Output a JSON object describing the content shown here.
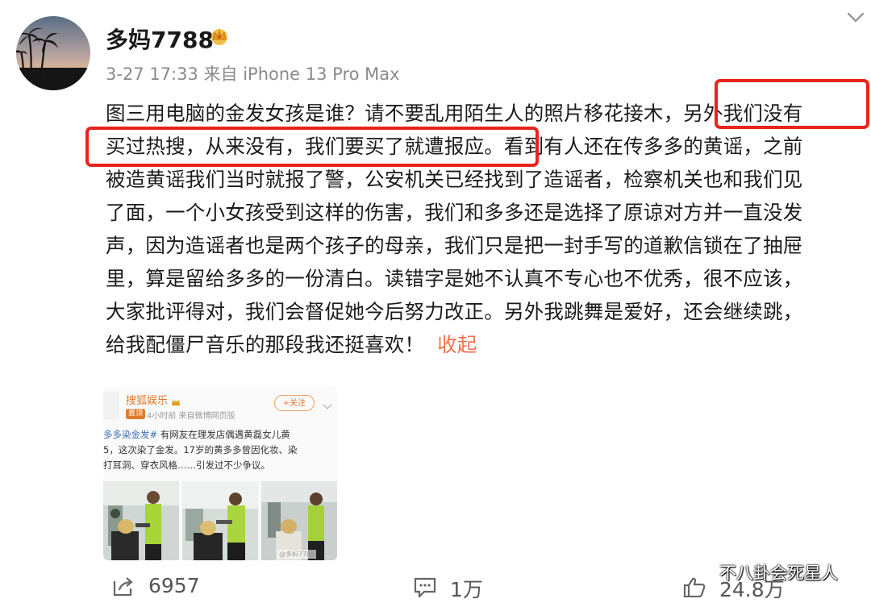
{
  "post": {
    "author": "多妈7788",
    "meta": "3-27 17:33  来自 iPhone 13 Pro Max",
    "lines": [
      "图三用电脑的金发女孩是谁？请不要乱用陌生人的照片移花接木，另外我们没有",
      "买过热搜，从来没有，我们要买了就遭报应。看到有人还在传多多的黄谣，之前",
      "被造黄谣我们当时就报了警，公安机关已经找到了造谣者，检察机关也和我们见",
      "了面，一个小女孩受到这样的伤害，我们和多多还是选择了原谅对方并一直没发",
      "声，因为造谣者也是两个孩子的母亲，我们只是把一封手写的道歉信锁在了抽屉",
      "里，算是留给多多的一份清白。读错字是她不认真不专心也不优秀，很不应该，",
      "大家批评得对，我们会督促她今后努力改正。另外我跳舞是爱好，还会继续跳，"
    ],
    "last_line": "给我配僵尸音乐的那段我还挺喜欢！",
    "collapse_label": "收起"
  },
  "embed": {
    "author": "搜狐娱乐",
    "tag": "置顶",
    "time": "4小时前  来自微博网页版",
    "follow_label": "+关注",
    "topic": "多多染金发#",
    "line1_rest": "有网友在理发店偶遇黄磊女儿黄",
    "line2": "5，这次染了金发。17岁的黄多多曾因化妆、染",
    "line3": "打耳洞、穿衣风格……引发过不少争议。",
    "photo_watermark": "@多妈7788"
  },
  "actions": {
    "repost_count": "6957",
    "comment_count": "1万",
    "like_count": "24.8万"
  },
  "watermark": "不八卦会死星人",
  "colors": {
    "highlight": "#e8231b",
    "link": "#eb7350",
    "meta": "#8a8a8a"
  },
  "icons": [
    "avatar-palm-sunset",
    "vip-crown-icon",
    "chevron-down-icon",
    "repost-icon",
    "comment-icon",
    "like-icon"
  ]
}
